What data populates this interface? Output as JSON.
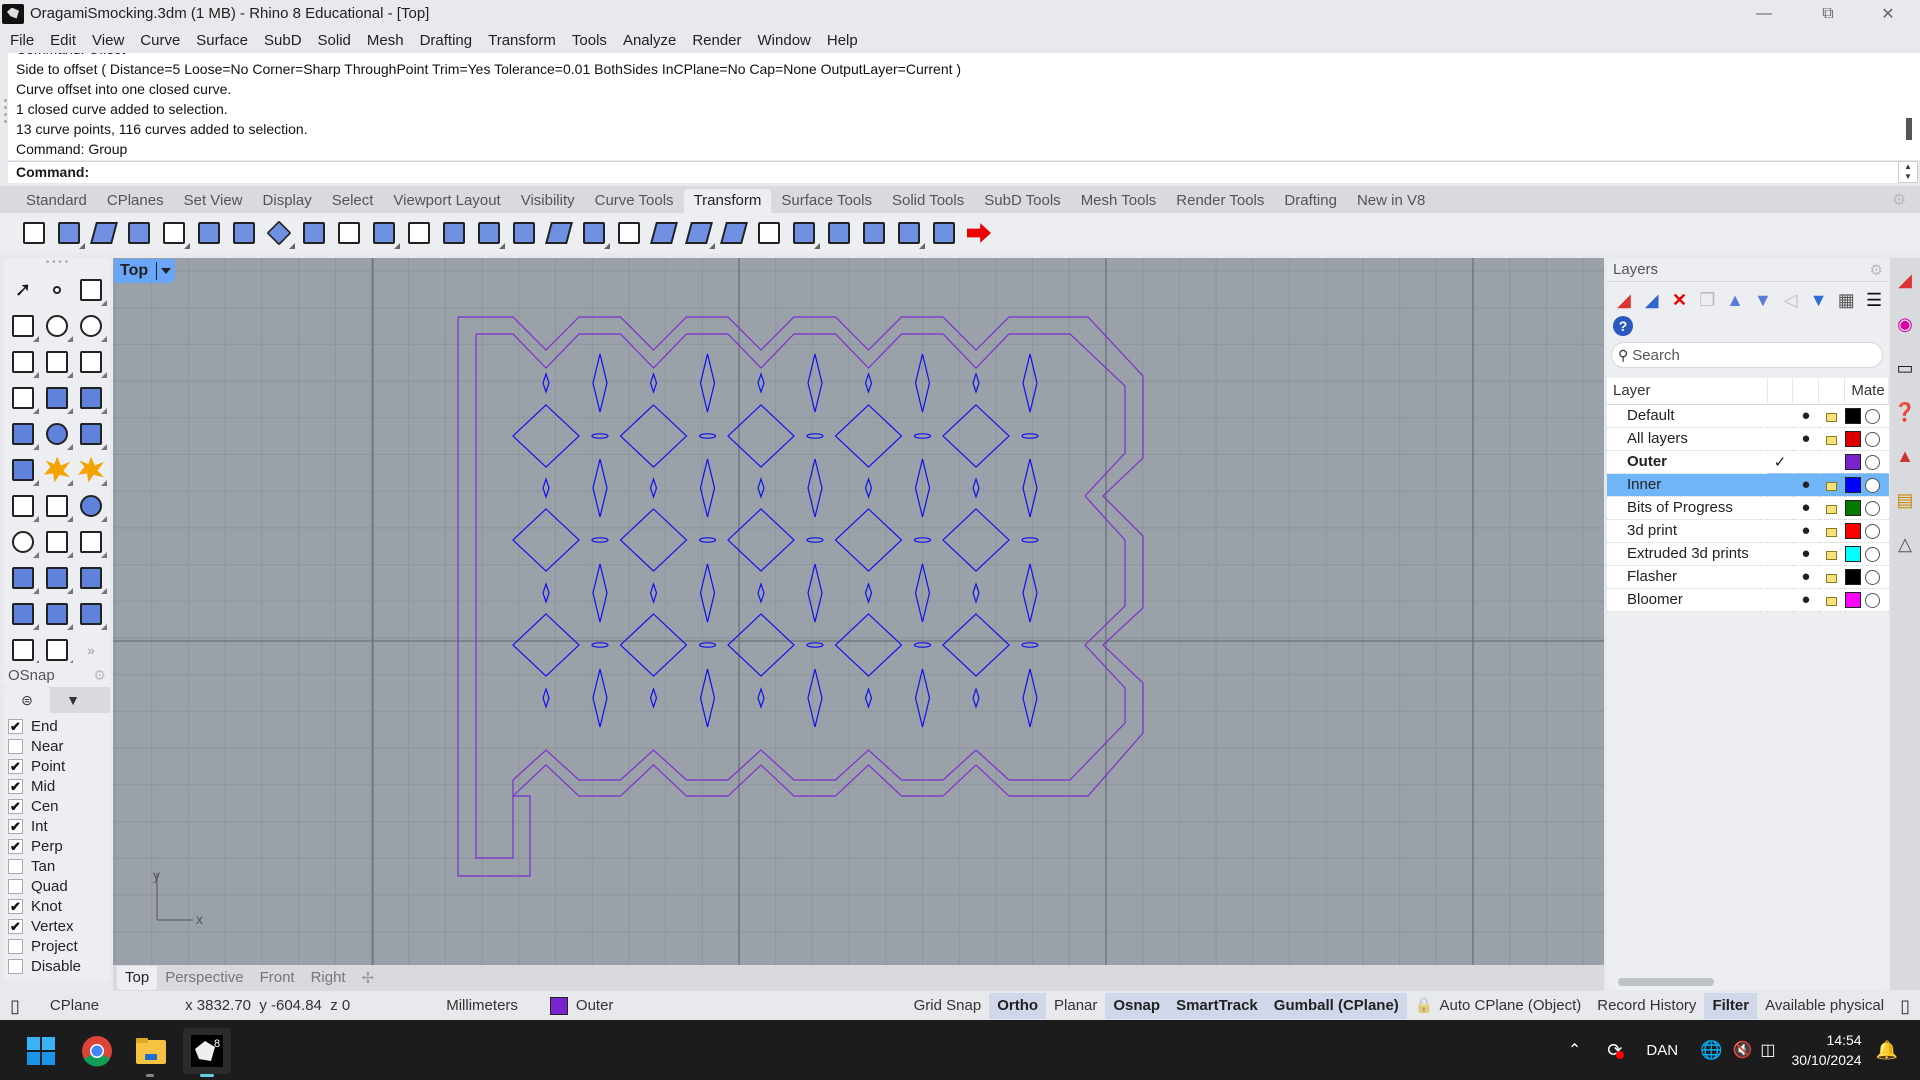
{
  "window": {
    "title": "OragamiSmocking.3dm (1 MB) - Rhino 8 Educational - [Top]",
    "controls": [
      "minimize",
      "restore",
      "close"
    ]
  },
  "menu": [
    "File",
    "Edit",
    "View",
    "Curve",
    "Surface",
    "SubD",
    "Solid",
    "Mesh",
    "Drafting",
    "Transform",
    "Tools",
    "Analyze",
    "Render",
    "Window",
    "Help"
  ],
  "command_history": [
    "Command: Offset",
    "Side to offset ( Distance=5  Loose=No  Corner=Sharp  ThroughPoint  Trim=Yes  Tolerance=0.01  BothSides  InCPlane=No  Cap=None  OutputLayer=Current )",
    "Curve offset into one closed curve.",
    "1 closed curve added to selection.",
    "13 curve points, 116 curves added to selection.",
    "Command: Group"
  ],
  "command_prompt": "Command:",
  "toolbar_tabs": {
    "items": [
      "Standard",
      "CPlanes",
      "Set View",
      "Display",
      "Select",
      "Viewport Layout",
      "Visibility",
      "Curve Tools",
      "Transform",
      "Surface Tools",
      "Solid Tools",
      "SubD Tools",
      "Mesh Tools",
      "Render Tools",
      "Drafting",
      "New in V8"
    ],
    "active": "Transform"
  },
  "transform_tools": [
    "move-icon",
    "copy-icon",
    "rotate-icon",
    "scale-icon",
    "mirror-icon",
    "array-icon",
    "orient-icon",
    "align-icon",
    "flow-icon",
    "project-icon",
    "twist-icon",
    "bend-icon",
    "setpt-icon",
    "array-grid-icon",
    "array-polar-icon",
    "orient-3pt-icon",
    "array-curve-icon",
    "gumball-icon",
    "taper-icon",
    "stretch-icon",
    "flow-surface-icon",
    "shear-icon",
    "splop-icon",
    "smash-icon",
    "cage-edit-icon",
    "box-edit-icon",
    "unroll-icon",
    "extend-arrow-icon"
  ],
  "toolbox_icons": [
    "select-icon",
    "point-icon",
    "polyline-icon",
    "curve-icon",
    "circle-icon",
    "ellipse-icon",
    "arc-icon",
    "rectangle-icon",
    "polygon-icon",
    "fillet-icon",
    "surface-corner-icon",
    "sweep-icon",
    "box-icon",
    "sphere-icon",
    "cylinder-icon",
    "extrude-surface-icon",
    "boolean-union-icon",
    "explode-icon",
    "trim-icon",
    "split-icon",
    "boolean-icon",
    "group-icon",
    "offset-icon",
    "blend-icon",
    "text-icon",
    "scale-tool-icon",
    "array-tool-icon",
    "mirror-tool-icon",
    "solid-edit-icon",
    "extrude-icon",
    "array-rect-icon",
    "gumball-tool-icon",
    "more-icon"
  ],
  "osnap": {
    "title": "OSnap",
    "items": [
      {
        "label": "End",
        "checked": true
      },
      {
        "label": "Near",
        "checked": false
      },
      {
        "label": "Point",
        "checked": true
      },
      {
        "label": "Mid",
        "checked": true
      },
      {
        "label": "Cen",
        "checked": true
      },
      {
        "label": "Int",
        "checked": true
      },
      {
        "label": "Perp",
        "checked": true
      },
      {
        "label": "Tan",
        "checked": false
      },
      {
        "label": "Quad",
        "checked": false
      },
      {
        "label": "Knot",
        "checked": true
      },
      {
        "label": "Vertex",
        "checked": true
      },
      {
        "label": "Project",
        "checked": false
      },
      {
        "label": "Disable",
        "checked": false
      }
    ]
  },
  "viewport": {
    "name": "Top",
    "axis_x": "x",
    "axis_y": "y",
    "colors": {
      "background": "#9aa1a9",
      "outer_curve": "#7a2fd0",
      "inner_curve": "#1010ee"
    },
    "tabs": [
      "Top",
      "Perspective",
      "Front",
      "Right"
    ],
    "active_tab": "Top"
  },
  "layers": {
    "title": "Layers",
    "search_placeholder": "Search",
    "columns": [
      "Layer",
      "Mate"
    ],
    "rows": [
      {
        "name": "Default",
        "color": "#000000",
        "current": false,
        "selected": false
      },
      {
        "name": "All layers",
        "color": "#dd0000",
        "current": false,
        "selected": false
      },
      {
        "name": "Outer",
        "color": "#7a22cc",
        "current": true,
        "selected": false
      },
      {
        "name": "Inner",
        "color": "#0000ff",
        "current": false,
        "selected": true
      },
      {
        "name": "Bits of Progress",
        "color": "#007a00",
        "current": false,
        "selected": false
      },
      {
        "name": "3d print",
        "color": "#ff0000",
        "current": false,
        "selected": false
      },
      {
        "name": "Extruded 3d prints",
        "color": "#00ffff",
        "current": false,
        "selected": false
      },
      {
        "name": "Flasher",
        "color": "#000000",
        "current": false,
        "selected": false
      },
      {
        "name": "Bloomer",
        "color": "#ff00ff",
        "current": false,
        "selected": false
      }
    ]
  },
  "statusbar": {
    "cplane": "CPlane",
    "coords": "x 3832.70  y -604.84  z 0",
    "units": "Millimeters",
    "layer": "Outer",
    "layer_color": "#7a22cc",
    "panes": [
      {
        "label": "Grid Snap",
        "on": false
      },
      {
        "label": "Ortho",
        "on": true
      },
      {
        "label": "Planar",
        "on": false
      },
      {
        "label": "Osnap",
        "on": true
      },
      {
        "label": "SmartTrack",
        "on": true
      },
      {
        "label": "Gumball (CPlane)",
        "on": true
      },
      {
        "label": "Auto CPlane (Object)",
        "on": false
      },
      {
        "label": "Record History",
        "on": false
      },
      {
        "label": "Filter",
        "on": true
      },
      {
        "label": "Available physical",
        "on": false
      }
    ]
  },
  "taskbar": {
    "apps": [
      "windows-start-icon",
      "chrome-icon",
      "file-explorer-icon",
      "rhino-8-icon"
    ],
    "language": "DAN",
    "time": "14:54",
    "date": "30/10/2024"
  }
}
